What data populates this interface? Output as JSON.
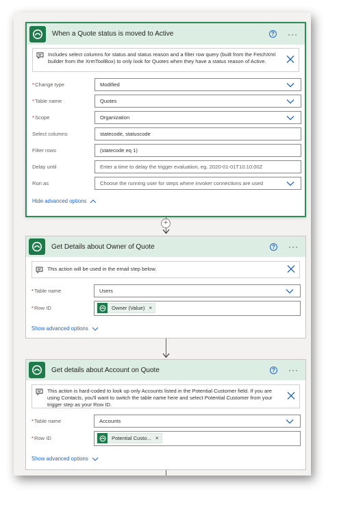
{
  "trigger": {
    "title": "When a Quote status is moved to Active",
    "note": "Includes select columns for status and status reason and a filter row query (built from the FetchXml builder from the XrmToolBox) to only look for Quotes when they have a status reason of Active.",
    "fields": [
      {
        "label": "Change type",
        "required": "*",
        "value": "Modified",
        "dropdown": true,
        "placeholder": false
      },
      {
        "label": "Table name",
        "required": "*",
        "value": "Quotes",
        "dropdown": true,
        "placeholder": false
      },
      {
        "label": "Scope",
        "required": "*",
        "value": "Organization",
        "dropdown": true,
        "placeholder": false
      },
      {
        "label": "Select columns",
        "required": "",
        "value": "statecode, statuscode",
        "dropdown": false,
        "placeholder": false
      },
      {
        "label": "Filter rows",
        "required": "",
        "value": "(statecode eq 1)",
        "dropdown": false,
        "placeholder": false
      },
      {
        "label": "Delay until",
        "required": "",
        "value": "Enter a time to delay the trigger evaluation, eg. 2020-01-01T10:10:00Z",
        "dropdown": false,
        "placeholder": true
      },
      {
        "label": "Run as",
        "required": "",
        "value": "Choose the running user for steps where invoker connections are used",
        "dropdown": true,
        "placeholder": true
      }
    ],
    "advanced_link": "Hide advanced options"
  },
  "owner_step": {
    "title": "Get Details about Owner of Quote",
    "note": "This action will be used in the email step below.",
    "table_label": "Table name",
    "table_value": "Users",
    "row_label": "Row ID",
    "row_token": "Owner (Value)",
    "advanced_link": "Show advanced options"
  },
  "account_step": {
    "title": "Get details about Account on Quote",
    "note": "This action is hard-coded to look up only Accounts listed in the Potential Customer field. If you are using Contacts, you'll want to switch the table name here and select Potential Customer from your trigger step as your Row ID.",
    "table_label": "Table name",
    "table_value": "Accounts",
    "row_label": "Row ID",
    "row_token": "Potential Custo...",
    "advanced_link": "Show advanced options"
  },
  "required_marker": "*",
  "icons": {
    "dataverse": "dataverse-logo-icon",
    "help": "help-icon",
    "more": "more-options-icon",
    "comment": "comment-icon",
    "close": "close-icon",
    "chevron": "chevron-down-icon"
  },
  "help_glyph": "?",
  "more_glyph": "···",
  "remove_glyph": "×",
  "plus_glyph": "+",
  "colors": {
    "header_bg": "#dcede3",
    "brand_green": "#1e7a4a",
    "link_blue": "#2266c2",
    "selected_border": "#2f8a58"
  }
}
